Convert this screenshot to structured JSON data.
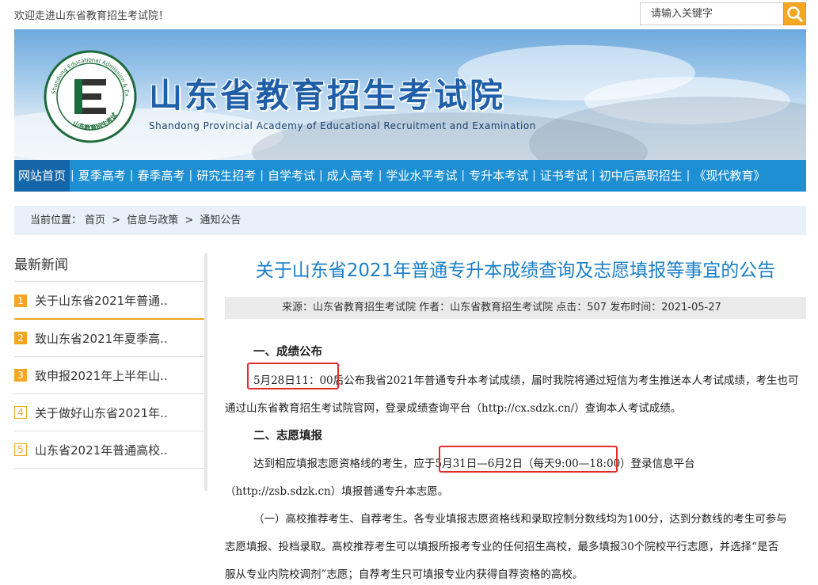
{
  "topbar": {
    "welcome": "欢迎走进山东省教育招生考试院！",
    "search_placeholder": "请输入关键字"
  },
  "banner": {
    "title": "山东省教育招生考试院",
    "subtitle": "Shandong Provincial Academy of Educational Recruitment and Examination",
    "logo_text": "Shandong Educational Admission & Examinations",
    "logo_cn": "山东教育招生考试"
  },
  "nav": [
    "网站首页",
    "夏季高考",
    "春季高考",
    "研究生招考",
    "自学考试",
    "成人高考",
    "学业水平考试",
    "专升本考试",
    "证书考试",
    "初中后高职招生",
    "《现代教育》"
  ],
  "breadcrumb": {
    "label": "当前位置：",
    "items": [
      "首页",
      ">",
      "信息与政策",
      ">",
      "通知公告"
    ]
  },
  "sidebar": {
    "title": "最新新闻",
    "items": [
      {
        "num": "1",
        "text": "关于山东省2021年普通.."
      },
      {
        "num": "2",
        "text": "致山东省2021年夏季高.."
      },
      {
        "num": "3",
        "text": "致申报2021年上半年山.."
      },
      {
        "num": "4",
        "text": "关于做好山东省2021年.."
      },
      {
        "num": "5",
        "text": "山东省2021年普通高校.."
      }
    ]
  },
  "article": {
    "title": "关于山东省2021年普通专升本成绩查询及志愿填报等事宜的公告",
    "meta": "来源：山东省教育招生考试院 作者：山东省教育招生考试院 点击：507 发布时间：2021-05-27",
    "s1_heading": "一、成绩公布",
    "s1_p1_date": "5月28日11：00",
    "s1_p1_rest": "后公布我省2021年普通专升本考试成绩，届时我院将通过短信为考生推送本人考试成绩，考生也可",
    "s1_p2": "通过山东省教育招生考试院官网，登录成绩查询平台（http://cx.sdzk.cn/）查询本人考试成绩。",
    "s2_heading": "二、志愿填报",
    "s2_p1_a": "达到相应填报志愿资格线的考生，应于",
    "s2_p1_date": "5月31日—6月2日（每天9:00—18:00）",
    "s2_p1_b": "登录信息平台",
    "s2_p2": "（http://zsb.sdzk.cn）填报普通专升本志愿。",
    "s2_p3": "（一）高校推荐考生、自荐考生。各专业填报志愿资格线和录取控制分数线均为100分，达到分数线的考生可参与",
    "s2_p4": "志愿填报、投档录取。高校推荐考生可以填报所报考专业的任何招生高校，最多填报30个院校平行志愿，并选择“是否",
    "s2_p5": "服从专业内院校调剂”志愿；自荐考生只可填报专业内获得自荐资格的高校。"
  },
  "colors": {
    "accent": "#1e8fd2",
    "title_blue": "#1a7fc8",
    "orange": "#f5a623",
    "highlight_red": "#e42b2b"
  }
}
